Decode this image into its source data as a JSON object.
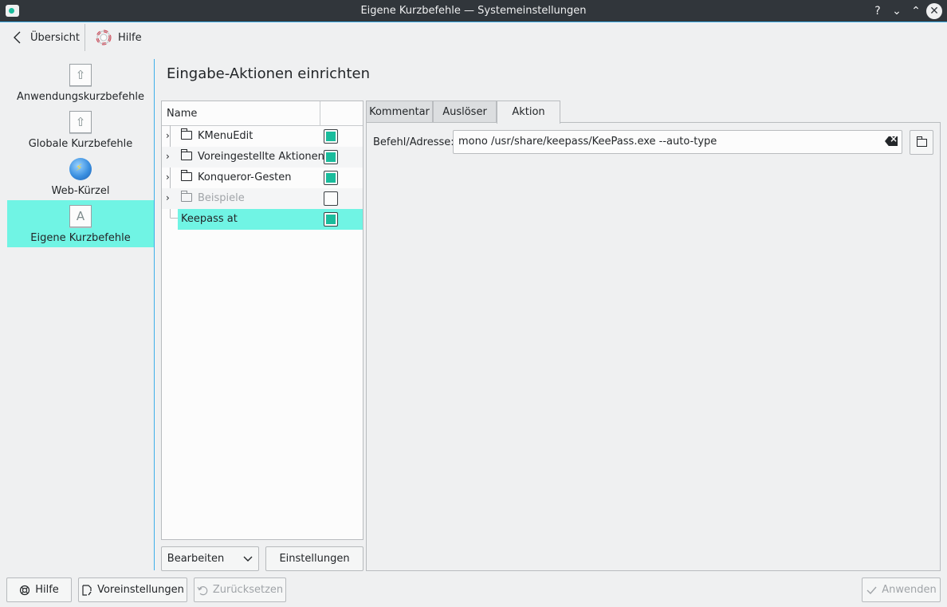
{
  "window": {
    "title": "Eigene Kurzbefehle  — Systemeinstellungen",
    "help_glyph": "?",
    "minimize_glyph": "⌄",
    "maximize_glyph": "⌃",
    "close_glyph": "✕"
  },
  "toolbar": {
    "back_label": "Übersicht",
    "help_label": "Hilfe"
  },
  "sidebar": {
    "items": [
      {
        "label": "Anwendungskurzbefehle",
        "icon": "keyboard-key-icon"
      },
      {
        "label": "Globale Kurzbefehle",
        "icon": "keyboard-key-icon"
      },
      {
        "label": "Web-Kürzel",
        "icon": "globe-icon"
      },
      {
        "label": "Eigene Kurzbefehle",
        "icon": "letter-key-icon",
        "key_letter": "A",
        "active": true
      }
    ]
  },
  "page": {
    "title": "Eingabe-Aktionen einrichten"
  },
  "tree": {
    "header_name": "Name",
    "rows": [
      {
        "label": "KMenuEdit",
        "type": "folder",
        "checked": true,
        "disabled": false
      },
      {
        "label": "Voreingestellte Aktionen",
        "type": "folder",
        "checked": true,
        "disabled": false
      },
      {
        "label": "Konqueror-Gesten",
        "type": "folder",
        "checked": true,
        "disabled": false
      },
      {
        "label": "Beispiele",
        "type": "folder",
        "checked": false,
        "disabled": true
      },
      {
        "label": "Keepass at",
        "type": "action",
        "checked": true,
        "selected": true
      }
    ],
    "edit_button": "Bearbeiten",
    "settings_button": "Einstellungen"
  },
  "tabs": {
    "items": [
      "Kommentar",
      "Auslöser",
      "Aktion"
    ],
    "active": "Aktion"
  },
  "action": {
    "command_label": "Befehl/Adresse:",
    "command_value": "mono /usr/share/keepass/KeePass.exe --auto-type"
  },
  "footer": {
    "help_button": "Hilfe",
    "defaults_button": "Voreinstellungen",
    "reset_button": "Zurücksetzen",
    "apply_button": "Anwenden"
  },
  "colors": {
    "accent": "#3daee9",
    "selection": "#70f4e4",
    "checkbox_fill": "#1abc9c",
    "titlebar": "#31363b"
  }
}
